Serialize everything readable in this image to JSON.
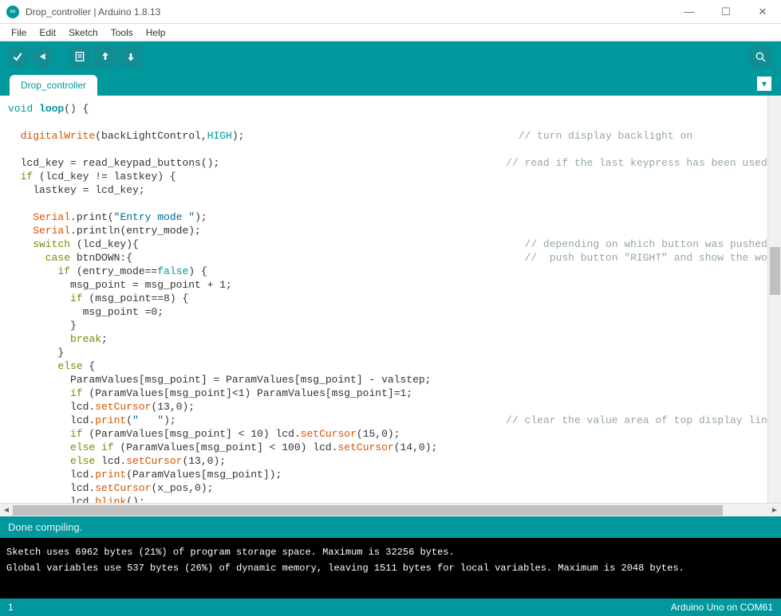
{
  "window": {
    "title": "Drop_controller | Arduino 1.8.13"
  },
  "menu": {
    "file": "File",
    "edit": "Edit",
    "sketch": "Sketch",
    "tools": "Tools",
    "help": "Help"
  },
  "tab": {
    "name": "Drop_controller"
  },
  "code": {
    "l1a": "void",
    "l1b": " loop",
    "l1c": "() {",
    "l2a": "  digitalWrite",
    "l2b": "(backLightControl,",
    "l2c": "HIGH",
    "l2d": ");",
    "l2cm": "// turn display backlight on",
    "l3": "  lcd_key = read_keypad_buttons();",
    "l3cm": "// read if the last keypress has been used",
    "l4a": "  if",
    "l4b": " (lcd_key != lastkey) {",
    "l5": "    lastkey = lcd_key;",
    "l6a": "    Serial",
    "l6b": ".print",
    "l6c": "(",
    "l6d": "\"Entry mode \"",
    "l6e": ");",
    "l7a": "    Serial",
    "l7b": ".println",
    "l7c": "(entry_mode);",
    "l8a": "    switch",
    "l8b": " (lcd_key){",
    "l8cm": "// depending on which button was pushed, we pe",
    "l9a": "      case",
    "l9b": " btnDOWN:{",
    "l9cm": "//  push button \"RIGHT\" and show the word on t",
    "l10a": "        if",
    "l10b": " (entry_mode==",
    "l10c": "false",
    "l10d": ") {",
    "l11": "          msg_point = msg_point + 1;",
    "l12a": "          if",
    "l12b": " (msg_point==8) {",
    "l13": "            msg_point =0;",
    "l14": "          }",
    "l15a": "          break",
    "l15b": ";",
    "l16": "        }",
    "l17a": "        else",
    "l17b": " {",
    "l18": "          ParamValues[msg_point] = ParamValues[msg_point] - valstep;",
    "l19a": "          if",
    "l19b": " (ParamValues[msg_point]<1) ParamValues[msg_point]=1;",
    "l20a": "          lcd.",
    "l20b": "setCursor",
    "l20c": "(13,0);",
    "l21a": "          lcd.",
    "l21b": "print",
    "l21c": "(",
    "l21d": "\"   \"",
    "l21e": ");",
    "l21cm": "// clear the value area of top display line",
    "l22a": "          if",
    "l22b": " (ParamValues[msg_point] < 10) lcd.",
    "l22c": "setCursor",
    "l22d": "(15,0);",
    "l23a": "          else if",
    "l23b": " (ParamValues[msg_point] < 100) lcd.",
    "l23c": "setCursor",
    "l23d": "(14,0);",
    "l24a": "          else",
    "l24b": " lcd.",
    "l24c": "setCursor",
    "l24d": "(13,0);",
    "l25a": "          lcd.",
    "l25b": "print",
    "l25c": "(ParamValues[msg_point]);",
    "l26a": "          lcd.",
    "l26b": "setCursor",
    "l26c": "(x_pos,0);",
    "l27a": "          lcd.",
    "l27b": "blink",
    "l27c": "();"
  },
  "status": {
    "text": "Done compiling."
  },
  "console": {
    "line1": "Sketch uses 6962 bytes (21%) of program storage space. Maximum is 32256 bytes.",
    "line2": "Global variables use 537 bytes (26%) of dynamic memory, leaving 1511 bytes for local variables. Maximum is 2048 bytes."
  },
  "footer": {
    "line": "1",
    "board": "Arduino Uno on COM61"
  }
}
